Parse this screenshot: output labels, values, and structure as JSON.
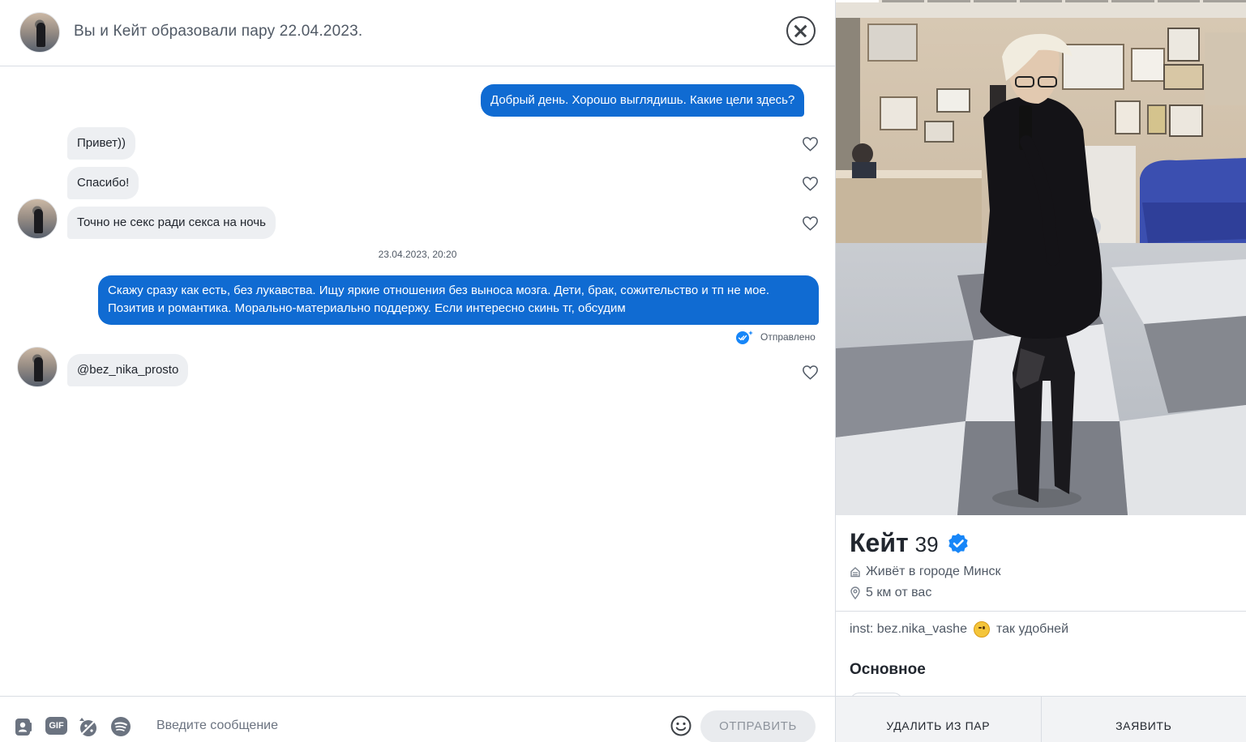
{
  "header": {
    "title": "Вы и Кейт образовали пару 22.04.2023."
  },
  "messages": [
    {
      "direction": "out",
      "text": "Добрый день. Хорошо выглядишь. Какие цели здесь?"
    },
    {
      "direction": "in",
      "text": "Привет))"
    },
    {
      "direction": "in",
      "text": "Спасибо!"
    },
    {
      "direction": "in",
      "text": "Точно не секс ради секса на ночь"
    },
    {
      "direction": "out",
      "text": "Скажу сразу как есть, без лукавства. Ищу яркие отношения без выноса мозга. Дети, брак, сожительство и тп не мое. Позитив и романтика. Морально-материально поддержу. Если интересно скинь тг, обсудим"
    },
    {
      "direction": "in",
      "text": "@bez_nika_prosto"
    }
  ],
  "timestamp": "23.04.2023, 20:20",
  "sent_status": "Отправлено",
  "composer": {
    "gif_label": "GIF",
    "placeholder": "Введите сообщение",
    "send_label": "ОТПРАВИТЬ"
  },
  "profile": {
    "name": "Кейт",
    "age": "39",
    "city": "Живёт в городе Минск",
    "distance": "5 км от вас",
    "bio_before": "inst: bez.nika_vashe",
    "bio_after": "так удобней",
    "section_title": "Основное",
    "photo_count": 9,
    "photo_active_index": 0
  },
  "actions": {
    "unmatch_label": "УДАЛИТЬ ИЗ ПАР",
    "report_label": "ЗАЯВИТЬ"
  },
  "colors": {
    "accent": "#106bd2",
    "incoming_bubble": "#edeff2",
    "text_secondary": "#505965",
    "verified": "#1786f8"
  }
}
